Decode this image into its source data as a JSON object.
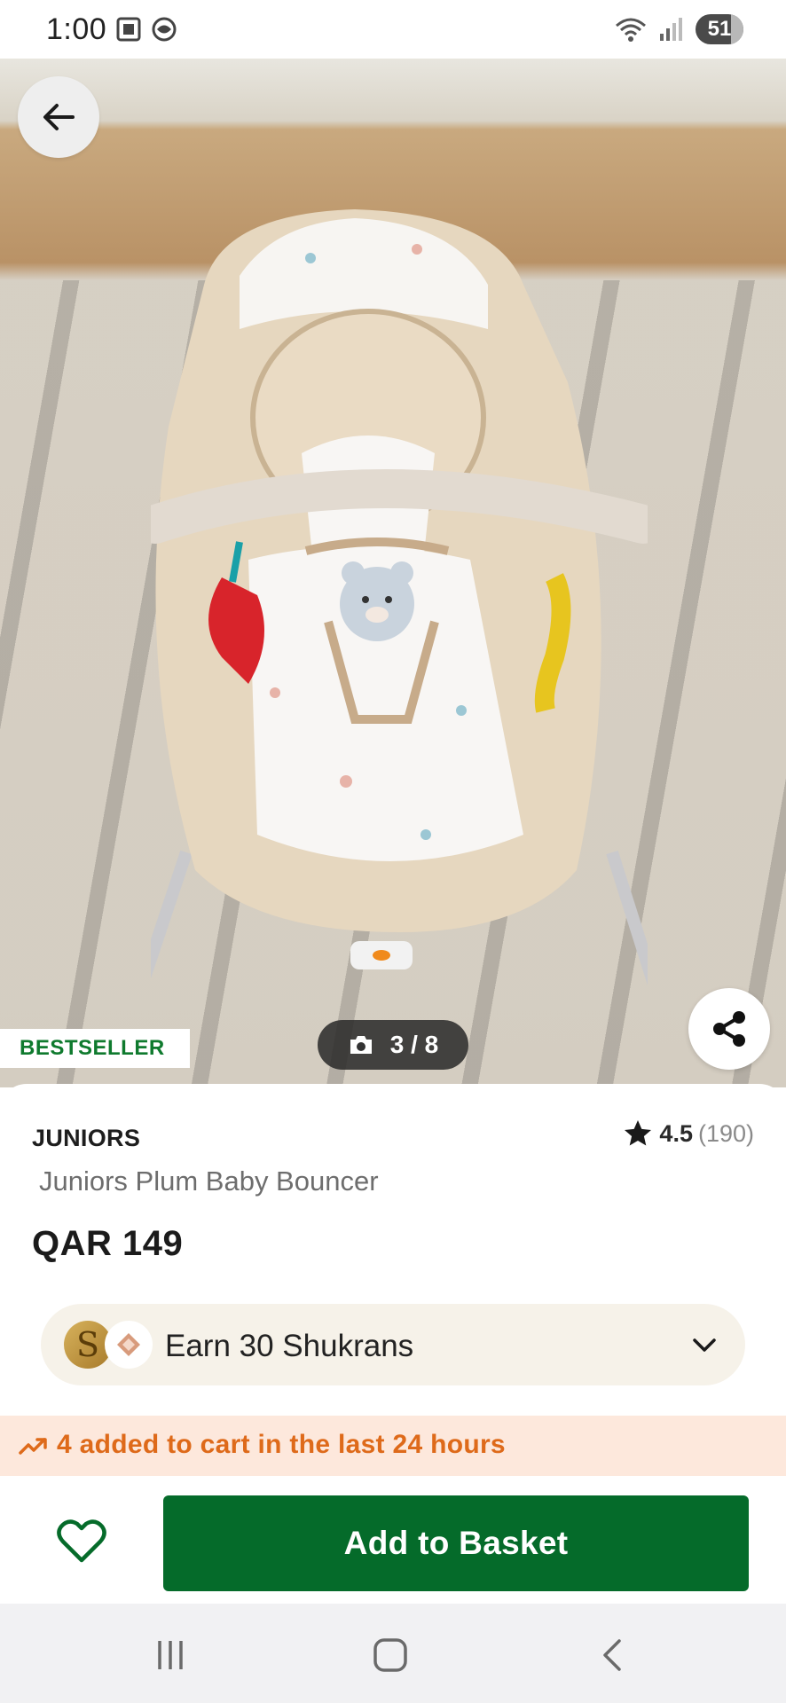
{
  "status_bar": {
    "time": "1:00",
    "battery": "51",
    "icons": [
      "screenshot-icon",
      "vpn-icon",
      "wifi-icon",
      "signal-icon",
      "battery-icon"
    ]
  },
  "gallery": {
    "counter": "3 / 8",
    "badge": "BESTSELLER",
    "icons": [
      "back-arrow-icon",
      "camera-icon",
      "share-icon"
    ]
  },
  "product": {
    "brand": "JUNIORS",
    "rating": "4.5",
    "rating_count": "(190)",
    "name": "Juniors Plum Baby Bouncer",
    "price": "QAR 149"
  },
  "shukran": {
    "coin_letter": "S",
    "label": "Earn 30 Shukrans"
  },
  "trend": {
    "text": "4 added to cart in the last 24 hours"
  },
  "actions": {
    "add_to_basket": "Add to Basket"
  },
  "colors": {
    "brand_green": "#056b2a",
    "badge_green": "#0f7a2e",
    "trend_orange": "#de6a1a",
    "trend_bg": "#fde8dc",
    "shukran_bg": "#f6f2e9"
  }
}
